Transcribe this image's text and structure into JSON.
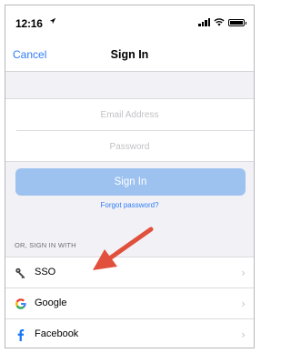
{
  "status_bar": {
    "time": "12:16",
    "location_icon": "location-arrow-icon",
    "signal_icon": "cellular-signal-icon",
    "wifi_icon": "wifi-icon",
    "battery_icon": "battery-icon"
  },
  "nav": {
    "cancel_label": "Cancel",
    "title": "Sign In"
  },
  "form": {
    "email_placeholder": "Email Address",
    "password_placeholder": "Password",
    "signin_label": "Sign In",
    "forgot_label": "Forgot password?"
  },
  "alt_signin": {
    "header": "OR, SIGN IN WITH",
    "items": [
      {
        "label": "SSO",
        "icon": "key-icon"
      },
      {
        "label": "Google",
        "icon": "google-icon"
      },
      {
        "label": "Facebook",
        "icon": "facebook-icon"
      }
    ],
    "chevron": "›"
  },
  "colors": {
    "accent": "#2f7cf6",
    "button_disabled": "#9ec2f0",
    "annotation_arrow": "#e0503c",
    "background": "#f2f2f6"
  }
}
